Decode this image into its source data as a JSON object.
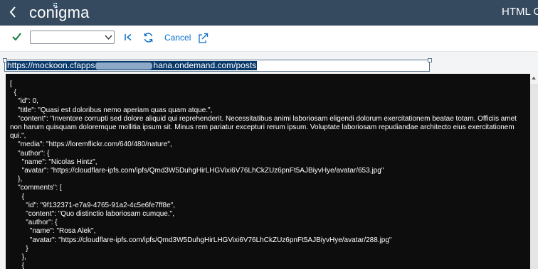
{
  "header": {
    "back_icon": "chevron-left-icon",
    "logo_text": "conigma",
    "title": "HTML C"
  },
  "toolbar": {
    "confirm_icon": "checkmark-icon",
    "select_value": "",
    "first_icon": "first-page-icon",
    "refresh_icon": "refresh-icon",
    "cancel_label": "Cancel",
    "export_icon": "export-icon"
  },
  "url": {
    "prefix": "https://mockoon.cfapps",
    "suffix": "hana.ondemand.com/posts"
  },
  "editor": {
    "lines": [
      "[",
      "  {",
      "    \"id\": 0,",
      "    \"title\": \"Quasi est doloribus nemo aperiam quas quam atque.\",",
      "    \"content\": \"Inventore corrupti sed dolore aliquid qui reprehenderit. Necessitatibus animi laboriosam eligendi dolorum exercitationem beatae totam. Officiis amet non harum quisquam doloremque mollitia ipsum sit. Minus rem pariatur excepturi rerum ipsum. Voluptate laboriosam repudiandae architecto eius exercitationem qui.\",",
      "    \"media\": \"https://loremflickr.com/640/480/nature\",",
      "    \"author\": {",
      "      \"name\": \"Nicolas Hintz\",",
      "      \"avatar\": \"https://cloudflare-ipfs.com/ipfs/Qmd3W5DuhgHirLHGVixi6V76LhCkZUz6pnFt5AJBiyvHye/avatar/653.jpg\"",
      "    },",
      "    \"comments\": [",
      "      {",
      "        \"id\": \"9f132371-e7a9-4765-91a2-4c5e6fe7ff8e\",",
      "        \"content\": \"Quo distinctio laboriosam cumque.\",",
      "        \"author\": {",
      "          \"name\": \"Rosa Alek\",",
      "          \"avatar\": \"https://cloudflare-ipfs.com/ipfs/Qmd3W5DuhgHirLHGVixi6V76LhCkZUz6pnFt5AJBiyvHye/avatar/288.jpg\"",
      "        }",
      "      },",
      "      {"
    ]
  },
  "colors": {
    "shell": "#354a5f",
    "accent": "#0a6ed1",
    "editor_bg": "#0d0d0d",
    "selection": "#0a3a6b"
  }
}
